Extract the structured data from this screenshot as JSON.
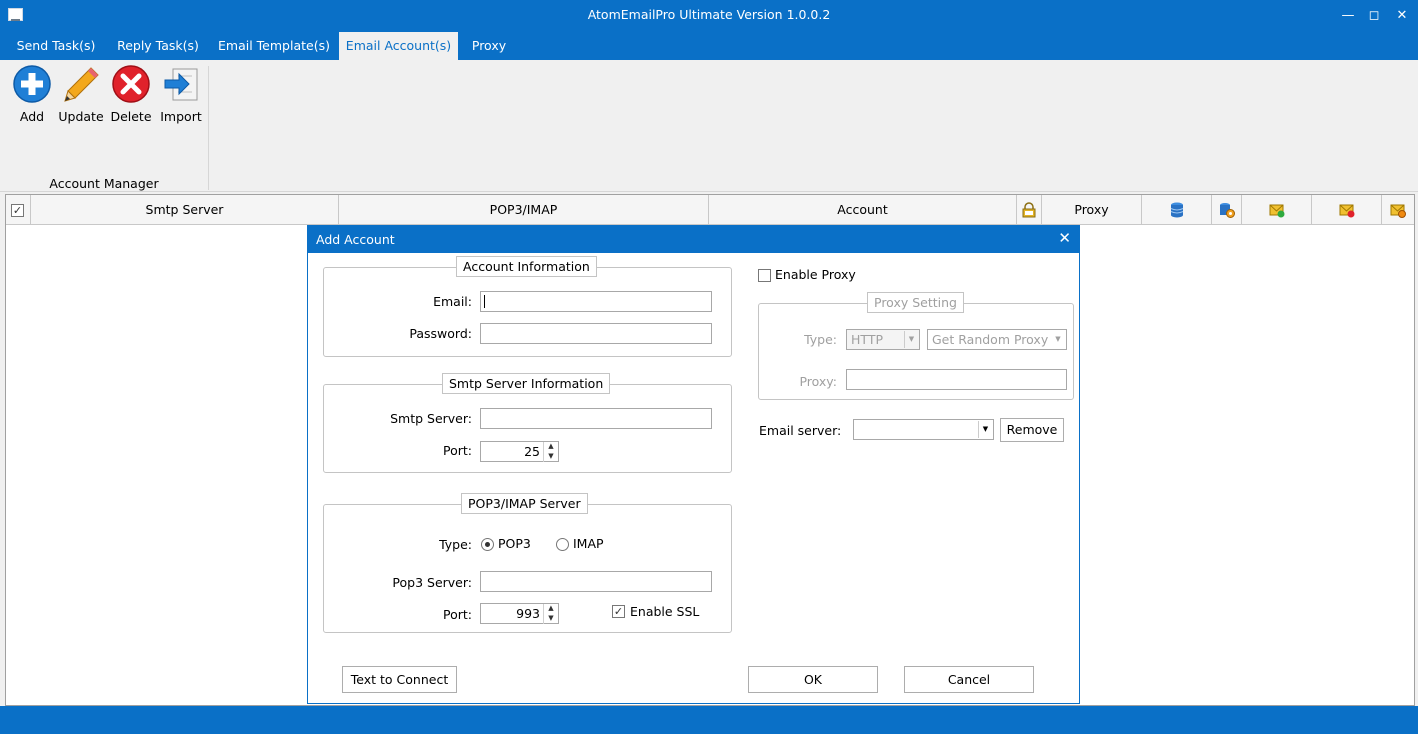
{
  "window": {
    "title": "AtomEmailPro Ultimate Version 1.0.0.2"
  },
  "tabs": [
    "Send Task(s)",
    "Reply Task(s)",
    "Email Template(s)",
    "Email Account(s)",
    "Proxy"
  ],
  "active_tab": "Email Account(s)",
  "ribbon": {
    "buttons": {
      "add": "Add",
      "update": "Update",
      "delete": "Delete",
      "import": "Import"
    },
    "group_label": "Account Manager"
  },
  "grid": {
    "columns": {
      "smtp": "Smtp Server",
      "pop3": "POP3/IMAP",
      "account": "Account",
      "proxy": "Proxy"
    },
    "icon_columns": [
      "ssl-icon",
      "database-icon",
      "database-gear-icon",
      "mail-send-icon",
      "mail-error-icon",
      "mail-settings-icon"
    ]
  },
  "dialog": {
    "title": "Add Account",
    "account_info": {
      "legend": "Account Information",
      "email_label": "Email:",
      "email_value": "",
      "password_label": "Password:",
      "password_value": ""
    },
    "smtp_info": {
      "legend": "Smtp Server Information",
      "server_label": "Smtp Server:",
      "server_value": "",
      "port_label": "Port:",
      "port_value": "25"
    },
    "pop3_info": {
      "legend": "POP3/IMAP Server",
      "type_label": "Type:",
      "type_options": [
        "POP3",
        "IMAP"
      ],
      "type_selected": "POP3",
      "server_label": "Pop3 Server:",
      "server_value": "",
      "port_label": "Port:",
      "port_value": "993",
      "ssl_label": "Enable SSL",
      "ssl_checked": true
    },
    "proxy": {
      "enable_label": "Enable Proxy",
      "enabled": false,
      "legend": "Proxy Setting",
      "type_label": "Type:",
      "type_value": "HTTP",
      "mode_value": "Get Random Proxy",
      "proxy_label": "Proxy:",
      "proxy_value": ""
    },
    "email_server": {
      "label": "Email server:",
      "value": "",
      "remove_label": "Remove"
    },
    "buttons": {
      "test_connect": "Text to Connect",
      "ok": "OK",
      "cancel": "Cancel"
    }
  },
  "colors": {
    "accent": "#0a70c7",
    "background": "#f0f0f0"
  }
}
